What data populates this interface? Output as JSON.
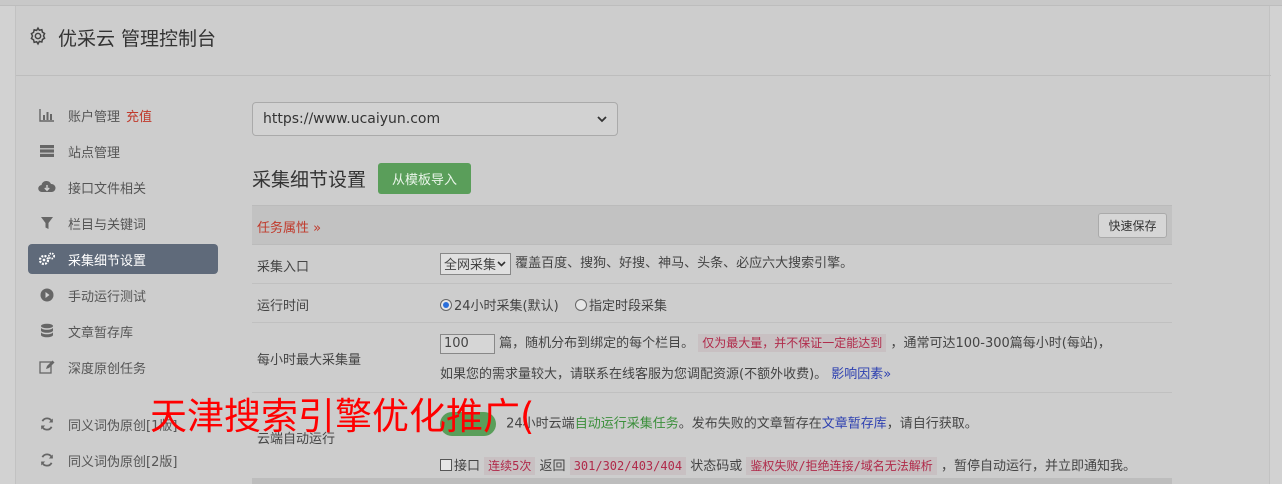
{
  "header": {
    "title": "优采云 管理控制台"
  },
  "sidebar": {
    "items": [
      {
        "label": "账户管理",
        "extra": "充值"
      },
      {
        "label": "站点管理"
      },
      {
        "label": "接口文件相关"
      },
      {
        "label": "栏目与关键词"
      },
      {
        "label": "采集细节设置"
      },
      {
        "label": "手动运行测试"
      },
      {
        "label": "文章暂存库"
      },
      {
        "label": "深度原创任务"
      },
      {
        "label": "同义词伪原创[1版]"
      },
      {
        "label": "同义词伪原创[2版]"
      }
    ]
  },
  "main": {
    "site_select": "https://www.ucaiyun.com",
    "section_title": "采集细节设置",
    "import_button": "从模板导入",
    "task_attr": "任务属性 »",
    "quick_save": "快速保存",
    "rows": {
      "entry": {
        "label": "采集入口",
        "select": "全网采集",
        "desc": "覆盖百度、搜狗、好搜、神马、头条、必应六大搜索引擎。"
      },
      "runtime": {
        "label": "运行时间",
        "opt1": "24小时采集(默认)",
        "opt2": "指定时段采集"
      },
      "max": {
        "label": "每小时最大采集量",
        "value": "100",
        "t1": "篇，随机分布到绑定的每个栏目。",
        "warn": "仅为最大量，并不保证一定能达到",
        "t2": "，通常可达100-300篇每小时(每站)，",
        "t3": "如果您的需求量较大，请联系在线客服为您调配资源(不额外收费)。",
        "link": "影响因素»"
      },
      "cloud": {
        "label": "云端自动运行",
        "t1": "24小时云端",
        "green": "自动运行采集任务",
        "t2": "。发布失败的文章暂存在",
        "link": "文章暂存库",
        "t3": "，请自行获取。",
        "c_prefix": "接口",
        "c_warn1": "连续5次",
        "c_t1": "返回",
        "c_warn2": "301/302/403/404",
        "c_t2": "状态码或",
        "c_warn3": "鉴权失败/拒绝连接/域名无法解析",
        "c_t3": "，暂停自动运行，并立即通知我。"
      }
    }
  },
  "overlay_text": "天津搜索引擎优化推广("
}
